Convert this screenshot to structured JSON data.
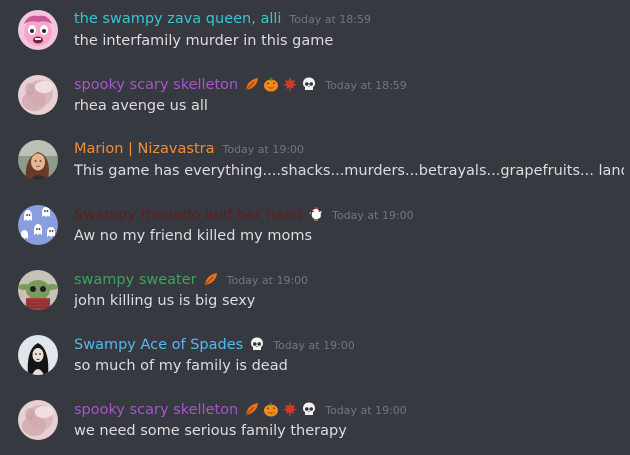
{
  "messages": [
    {
      "username": "the swampy zava queen, alli",
      "name_color": "#36c5d6",
      "avatar": "pink-cartoon-avatar",
      "timestamp": "Today at 18:59",
      "content": "the interfamily murder in this game",
      "emojis": []
    },
    {
      "username": "spooky scary skelleton",
      "name_color": "#a855c9",
      "avatar": "blurred-face-avatar",
      "timestamp": "Today at 18:59",
      "content": "rhea avenge us all",
      "emojis": [
        "leaf-emoji",
        "jack-o-lantern-emoji",
        "maple-leaf-emoji",
        "skull-emoji"
      ]
    },
    {
      "username": "Marion | Nizavastra",
      "name_color": "#f08d3c",
      "avatar": "woman-photo-avatar",
      "timestamp": "Today at 19:00",
      "content": "This game has everything....shacks...murders...betrayals...grapefruits... landmines...",
      "emojis": []
    },
    {
      "username": "Swampy rhenado and her hand",
      "name_color": "#5b1f1f",
      "avatar": "ghosts-pattern-avatar",
      "timestamp": "Today at 19:00",
      "content": "Aw no my friend killed my moms",
      "emojis": [
        "chicken-emoji"
      ]
    },
    {
      "username": "swampy sweater",
      "name_color": "#3ba55d",
      "avatar": "knit-creature-avatar",
      "timestamp": "Today at 19:00",
      "content": "john killing us is big sexy",
      "emojis": [
        "leaf-emoji"
      ]
    },
    {
      "username": "Swampy Ace of Spades",
      "name_color": "#56b8f0",
      "avatar": "dark-figure-avatar",
      "timestamp": "Today at 19:00",
      "content": "so much of my family is dead",
      "emojis": [
        "skull-emoji"
      ]
    },
    {
      "username": "spooky scary skelleton",
      "name_color": "#a855c9",
      "avatar": "blurred-face-avatar",
      "timestamp": "Today at 19:00",
      "content": "we need some serious family therapy",
      "emojis": [
        "leaf-emoji",
        "jack-o-lantern-emoji",
        "maple-leaf-emoji",
        "skull-emoji"
      ]
    }
  ]
}
